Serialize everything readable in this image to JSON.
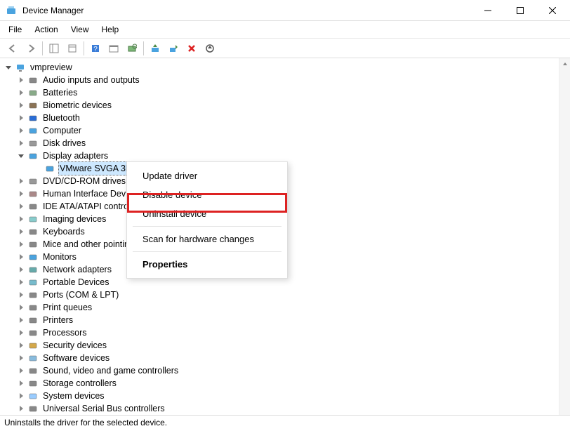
{
  "title": "Device Manager",
  "menu": {
    "file": "File",
    "action": "Action",
    "view": "View",
    "help": "Help"
  },
  "tree": {
    "root": "vmpreview",
    "categories": [
      {
        "label": "Audio inputs and outputs"
      },
      {
        "label": "Batteries"
      },
      {
        "label": "Biometric devices"
      },
      {
        "label": "Bluetooth"
      },
      {
        "label": "Computer"
      },
      {
        "label": "Disk drives"
      },
      {
        "label": "Display adapters",
        "expanded": true,
        "children": [
          {
            "label": "VMware SVGA 3D",
            "selected": true
          }
        ]
      },
      {
        "label": "DVD/CD-ROM drives"
      },
      {
        "label": "Human Interface Devices"
      },
      {
        "label": "IDE ATA/ATAPI controllers"
      },
      {
        "label": "Imaging devices"
      },
      {
        "label": "Keyboards"
      },
      {
        "label": "Mice and other pointing devices"
      },
      {
        "label": "Monitors"
      },
      {
        "label": "Network adapters"
      },
      {
        "label": "Portable Devices"
      },
      {
        "label": "Ports (COM & LPT)"
      },
      {
        "label": "Print queues"
      },
      {
        "label": "Printers"
      },
      {
        "label": "Processors"
      },
      {
        "label": "Security devices"
      },
      {
        "label": "Software devices"
      },
      {
        "label": "Sound, video and game controllers"
      },
      {
        "label": "Storage controllers"
      },
      {
        "label": "System devices"
      },
      {
        "label": "Universal Serial Bus controllers"
      }
    ]
  },
  "contextMenu": {
    "update": "Update driver",
    "disable": "Disable device",
    "uninstall": "Uninstall device",
    "scan": "Scan for hardware changes",
    "properties": "Properties"
  },
  "status": "Uninstalls the driver for the selected device."
}
